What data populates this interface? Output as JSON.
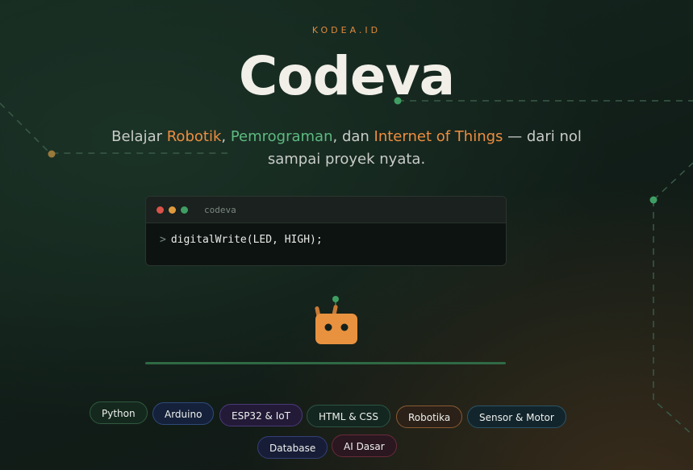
{
  "header": {
    "brand": "KODEA.ID",
    "title": "Codeva",
    "subtitle": {
      "part1": "Belajar ",
      "highlight1": "Robotik",
      "part2": ", ",
      "highlight2": "Pemrograman",
      "part3": ", dan ",
      "highlight3": "Internet of Things",
      "part4": " — dari nol sampai proyek nyata."
    }
  },
  "terminal": {
    "title": "codeva",
    "prompt": ">",
    "command": "digitalWrite(LED, HIGH);"
  },
  "mascot": {
    "icon": "robot-icon"
  },
  "tags": [
    {
      "label": "Python"
    },
    {
      "label": "Arduino"
    },
    {
      "label": "ESP32 & IoT"
    },
    {
      "label": "HTML & CSS"
    },
    {
      "label": "Robotika"
    },
    {
      "label": "Sensor & Motor"
    },
    {
      "label": "Database"
    },
    {
      "label": "AI Dasar"
    }
  ],
  "colors": {
    "accent_orange": "#ef8d3f",
    "accent_green": "#5dba80",
    "background": "#142219"
  }
}
